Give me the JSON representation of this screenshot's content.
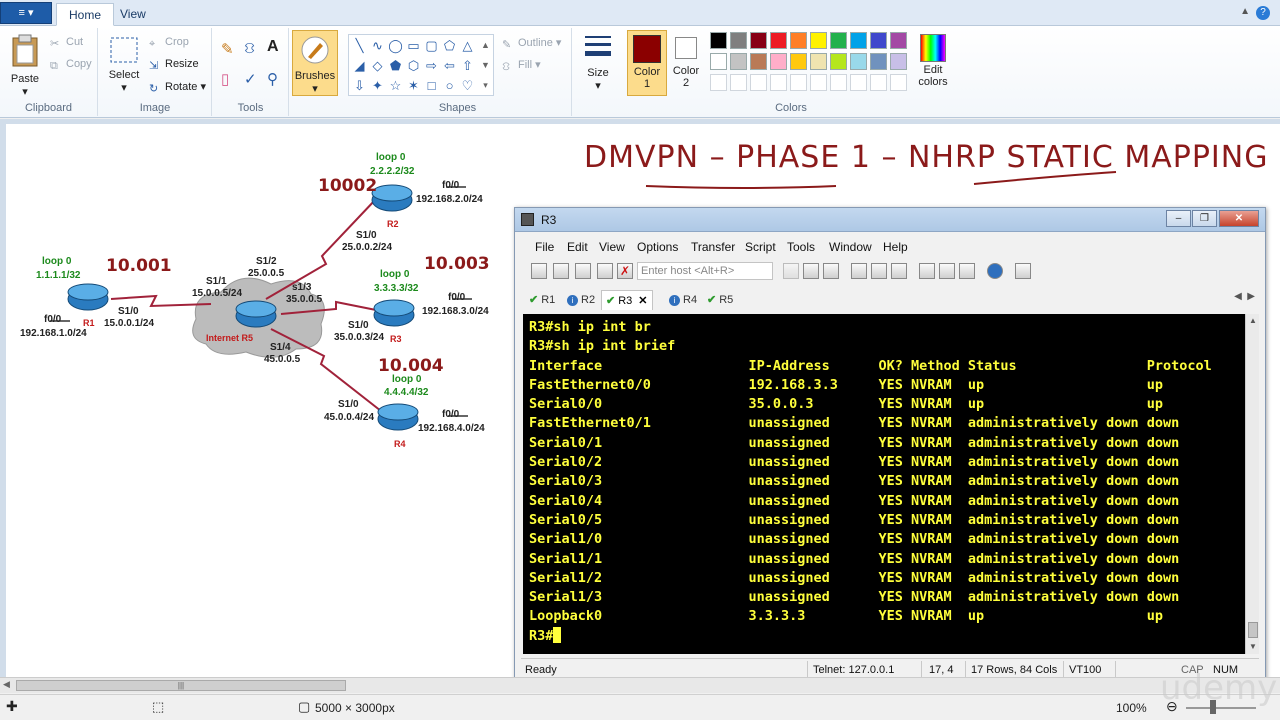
{
  "ribbon": {
    "app_menu_label": "≡ ▾",
    "tabs": [
      {
        "label": "Home",
        "active": true
      },
      {
        "label": "View",
        "active": false
      }
    ],
    "clipboard": {
      "paste": "Paste",
      "cut": "Cut",
      "copy": "Copy",
      "group": "Clipboard"
    },
    "image": {
      "select": "Select",
      "crop": "Crop",
      "resize": "Resize",
      "rotate": "Rotate",
      "group": "Image"
    },
    "tools": {
      "group": "Tools"
    },
    "brushes": {
      "label": "Brushes"
    },
    "shapes": {
      "outline": "Outline",
      "fill": "Fill",
      "group": "Shapes"
    },
    "size": {
      "label": "Size"
    },
    "color1": {
      "label": "Color",
      "num": "1",
      "value": "#8b0000"
    },
    "color2": {
      "label": "Color",
      "num": "2",
      "value": "#ffffff"
    },
    "colors": {
      "group": "Colors",
      "edit": "Edit",
      "edit2": "colors"
    },
    "palette_row1": [
      "#000000",
      "#7f7f7f",
      "#880015",
      "#ed1c24",
      "#ff7f27",
      "#fff200",
      "#22b14c",
      "#00a2e8",
      "#3f48cc",
      "#a349a4"
    ],
    "palette_row2": [
      "#ffffff",
      "#c3c3c3",
      "#b97a57",
      "#ffaec9",
      "#ffc90e",
      "#efe4b0",
      "#b5e61d",
      "#99d9ea",
      "#7092be",
      "#c8bfe7"
    ]
  },
  "canvas": {
    "heading": "DMVPN – PHASE 1  – NHRP STATIC MAPPING",
    "diagram": {
      "r1": {
        "loop_title": "loop 0",
        "loop_ip": "1.1.1.1/32",
        "name": "R1",
        "s10": "S1/0",
        "s10_ip": "15.0.0.1/24",
        "f00": "f0/0",
        "f00_ip": "192.168.1.0/24",
        "nbma": "10.001"
      },
      "r2": {
        "loop_title": "loop 0",
        "loop_ip": "2.2.2.2/32",
        "name": "R2",
        "f00": "f0/0",
        "f00_ip": "192.168.2.0/24",
        "s10": "S1/0",
        "s10_ip": "25.0.0.2/24",
        "nbma": "10002"
      },
      "r3": {
        "loop_title": "loop 0",
        "loop_ip": "3.3.3.3/32",
        "name": "R3",
        "f00": "f0/0",
        "f00_ip": "192.168.3.0/24",
        "s10": "S1/0",
        "s10_ip": "35.0.0.3/24",
        "nbma": "10.003"
      },
      "r4": {
        "loop_title": "loop 0",
        "loop_ip": "4.4.4.4/32",
        "name": "R4",
        "f00": "f0/0",
        "f00_ip": "192.168.4.0/24",
        "s10": "S1/0",
        "s10_ip": "45.0.0.4/24",
        "nbma": "10.004"
      },
      "r5": {
        "name": "Internet R5",
        "s11": "S1/1",
        "s11_ip": "15.0.0.5/24",
        "s12": "S1/2",
        "s12_ip": "25.0.0.5",
        "s13": "s1/3",
        "s13_ip": "35.0.0.5",
        "s14": "S1/4",
        "s14_ip": "45.0.0.5"
      }
    }
  },
  "crt": {
    "title": "R3",
    "menu": [
      "File",
      "Edit",
      "View",
      "Options",
      "Transfer",
      "Script",
      "Tools",
      "Window",
      "Help"
    ],
    "host_placeholder": "Enter host <Alt+R>",
    "tabs": [
      {
        "label": "R1",
        "state": "ok"
      },
      {
        "label": "R2",
        "state": "info"
      },
      {
        "label": "R3",
        "state": "ok",
        "active": true
      },
      {
        "label": "R4",
        "state": "info"
      },
      {
        "label": "R5",
        "state": "ok"
      }
    ],
    "terminal_lines": [
      "R3#sh ip int br",
      "R3#sh ip int brief",
      "Interface                  IP-Address      OK? Method Status                Protocol",
      "FastEthernet0/0            192.168.3.3     YES NVRAM  up                    up",
      "Serial0/0                  35.0.0.3        YES NVRAM  up                    up",
      "FastEthernet0/1            unassigned      YES NVRAM  administratively down down",
      "Serial0/1                  unassigned      YES NVRAM  administratively down down",
      "Serial0/2                  unassigned      YES NVRAM  administratively down down",
      "Serial0/3                  unassigned      YES NVRAM  administratively down down",
      "Serial0/4                  unassigned      YES NVRAM  administratively down down",
      "Serial0/5                  unassigned      YES NVRAM  administratively down down",
      "Serial1/0                  unassigned      YES NVRAM  administratively down down",
      "Serial1/1                  unassigned      YES NVRAM  administratively down down",
      "Serial1/2                  unassigned      YES NVRAM  administratively down down",
      "Serial1/3                  unassigned      YES NVRAM  administratively down down",
      "Loopback0                  3.3.3.3         YES NVRAM  up                    up"
    ],
    "prompt": "R3#",
    "status": {
      "ready": "Ready",
      "telnet": "Telnet: 127.0.0.1",
      "pos": "17,  4",
      "size": "17 Rows, 84 Cols",
      "term": "VT100",
      "cap": "CAP",
      "num": "NUM"
    }
  },
  "statusbar": {
    "dimensions": "5000 × 3000px",
    "zoom": "100%"
  },
  "watermark": "udemy"
}
